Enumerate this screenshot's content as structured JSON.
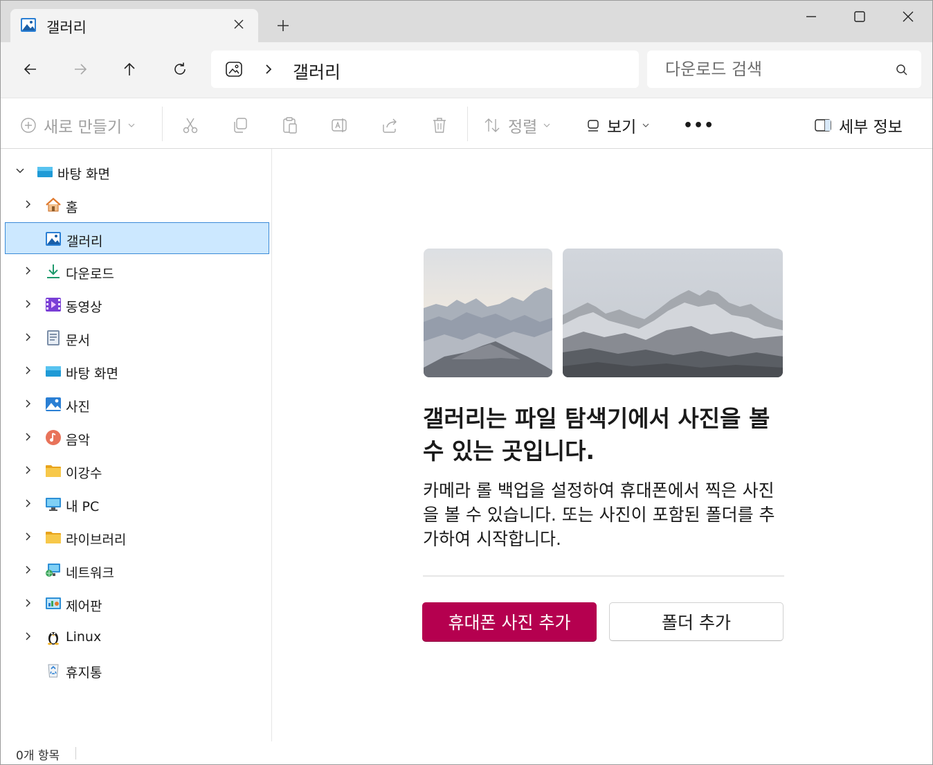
{
  "window": {
    "tab_title": "갤러리",
    "new_tab_symbol": "+",
    "controls": [
      "minimize",
      "maximize",
      "close"
    ]
  },
  "nav": {
    "breadcrumb": "갤러리",
    "search_placeholder": "다운로드 검색"
  },
  "toolbar": {
    "new_label": "새로 만들기",
    "sort_label": "정렬",
    "view_label": "보기",
    "more_label": "•••",
    "details_label": "세부 정보",
    "icons": [
      "cut-icon",
      "copy-icon",
      "paste-icon",
      "rename-icon",
      "share-icon",
      "delete-icon"
    ]
  },
  "sidebar": {
    "items": [
      {
        "label": "바탕 화면",
        "icon": "desktop-icon",
        "expanded": true
      },
      {
        "label": "홈",
        "icon": "home-icon"
      },
      {
        "label": "갤러리",
        "icon": "gallery-icon",
        "selected": true
      },
      {
        "label": "다운로드",
        "icon": "download-icon"
      },
      {
        "label": "동영상",
        "icon": "videos-icon"
      },
      {
        "label": "문서",
        "icon": "documents-icon"
      },
      {
        "label": "바탕 화면",
        "icon": "desktop-icon"
      },
      {
        "label": "사진",
        "icon": "pictures-icon"
      },
      {
        "label": "음악",
        "icon": "music-icon"
      },
      {
        "label": "이강수",
        "icon": "folder-icon"
      },
      {
        "label": "내 PC",
        "icon": "pc-icon"
      },
      {
        "label": "라이브러리",
        "icon": "folder-icon"
      },
      {
        "label": "네트워크",
        "icon": "network-icon"
      },
      {
        "label": "제어판",
        "icon": "control-panel-icon"
      },
      {
        "label": "Linux",
        "icon": "linux-icon"
      },
      {
        "label": "휴지통",
        "icon": "recycle-bin-icon"
      }
    ]
  },
  "main": {
    "headline": "갤러리는 파일 탐색기에서 사진을 볼 수 있는 곳입니다.",
    "description": "카메라 롤 백업을 설정하여 휴대폰에서 찍은 사진을 볼 수 있습니다. 또는 사진이 포함된 폴더를 추가하여 시작합니다.",
    "primary_button": "휴대폰 사진 추가",
    "secondary_button": "폴더 추가"
  },
  "status": {
    "item_count": "0개 항목"
  },
  "colors": {
    "accent": "#b5004f",
    "selection": "#cce8ff",
    "selection_border": "#3a8ad8"
  }
}
